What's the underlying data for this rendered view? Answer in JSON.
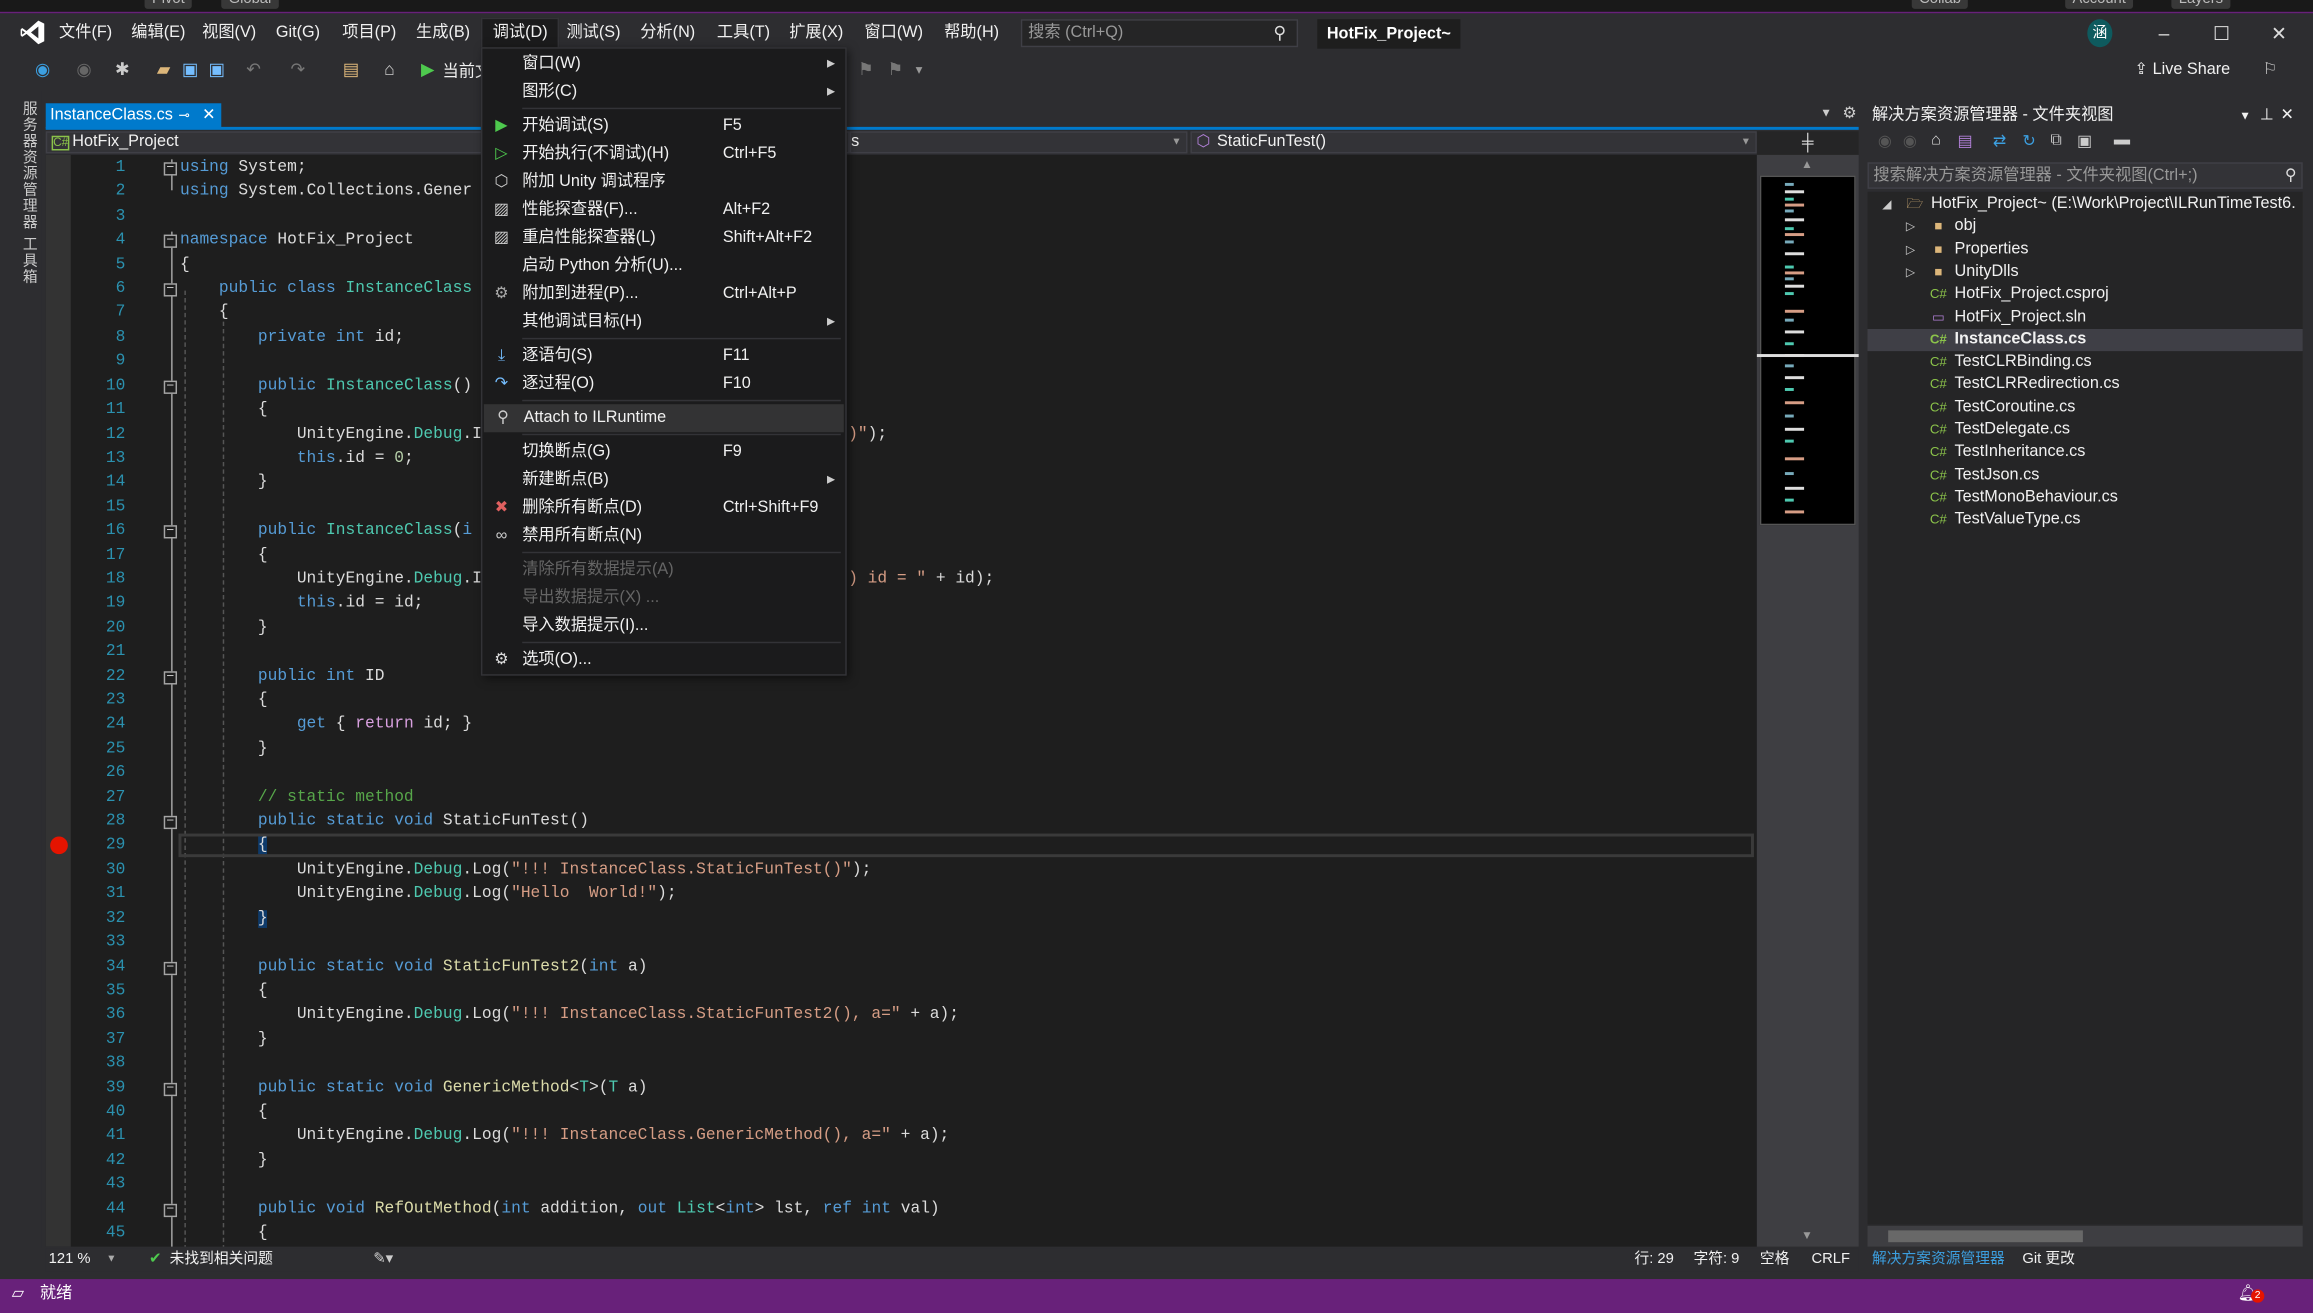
{
  "unity_bar": {
    "items": [
      "Pivot",
      "Global",
      "Collab",
      "Account",
      "Layers"
    ]
  },
  "menubar": {
    "items": [
      "文件(F)",
      "编辑(E)",
      "视图(V)",
      "Git(G)",
      "项目(P)",
      "生成(B)",
      "调试(D)",
      "测试(S)",
      "分析(N)",
      "工具(T)",
      "扩展(X)",
      "窗口(W)",
      "帮助(H)"
    ],
    "search_placeholder": "搜索 (Ctrl+Q)",
    "solution_title": "HotFix_Project~",
    "avatar": "涵"
  },
  "toolbar": {
    "start_label": "当前文",
    "live_share": "Live Share"
  },
  "left_strip": {
    "items": [
      "服务器资源管理器",
      "工具箱"
    ]
  },
  "document": {
    "tab_label": "InstanceClass.cs",
    "nav_project": "HotFix_Project",
    "nav_class_hint": "s",
    "nav_member": "StaticFunTest()"
  },
  "code": {
    "current_line": 29,
    "breakpoint_line": 29,
    "fold_lines": [
      1,
      4,
      6,
      10,
      16,
      22,
      28,
      34,
      39,
      44
    ],
    "lines": [
      {
        "n": "1",
        "t": [
          [
            "k",
            "using"
          ],
          [
            "p",
            " System;"
          ]
        ]
      },
      {
        "n": "2",
        "t": [
          [
            "k",
            "using"
          ],
          [
            "p",
            " System.Collections.Gener"
          ]
        ]
      },
      {
        "n": "3",
        "t": []
      },
      {
        "n": "4",
        "t": [
          [
            "k",
            "namespace"
          ],
          [
            "p",
            " HotFix_Project"
          ]
        ]
      },
      {
        "n": "5",
        "t": [
          [
            "p",
            "{"
          ]
        ]
      },
      {
        "n": "6",
        "t": [
          [
            "p",
            "    "
          ],
          [
            "k",
            "public class"
          ],
          [
            "p",
            " "
          ],
          [
            "t",
            "InstanceClass"
          ]
        ]
      },
      {
        "n": "7",
        "t": [
          [
            "p",
            "    {"
          ]
        ]
      },
      {
        "n": "8",
        "t": [
          [
            "p",
            "        "
          ],
          [
            "k",
            "private int"
          ],
          [
            "p",
            " id;"
          ]
        ]
      },
      {
        "n": "9",
        "t": []
      },
      {
        "n": "10",
        "t": [
          [
            "p",
            "        "
          ],
          [
            "k",
            "public"
          ],
          [
            "p",
            " "
          ],
          [
            "t",
            "InstanceClass"
          ],
          [
            "p",
            "()"
          ]
        ]
      },
      {
        "n": "11",
        "t": [
          [
            "p",
            "        {"
          ]
        ]
      },
      {
        "n": "12",
        "t": [
          [
            "p",
            "            UnityEngine."
          ],
          [
            "t",
            "Debug"
          ],
          [
            "p",
            ".I"
          ]
        ],
        "tail": [
          [
            "s",
            ")\""
          ],
          [
            "p",
            ");"
          ]
        ]
      },
      {
        "n": "13",
        "t": [
          [
            "p",
            "            "
          ],
          [
            "k",
            "this"
          ],
          [
            "p",
            ".id = "
          ],
          [
            "n",
            "0"
          ],
          [
            "p",
            ";"
          ]
        ]
      },
      {
        "n": "14",
        "t": [
          [
            "p",
            "        }"
          ]
        ]
      },
      {
        "n": "15",
        "t": []
      },
      {
        "n": "16",
        "t": [
          [
            "p",
            "        "
          ],
          [
            "k",
            "public"
          ],
          [
            "p",
            " "
          ],
          [
            "t",
            "InstanceClass"
          ],
          [
            "p",
            "("
          ],
          [
            "k",
            "i"
          ]
        ]
      },
      {
        "n": "17",
        "t": [
          [
            "p",
            "        {"
          ]
        ]
      },
      {
        "n": "18",
        "t": [
          [
            "p",
            "            UnityEngine."
          ],
          [
            "t",
            "Debug"
          ],
          [
            "p",
            ".I"
          ]
        ],
        "tail": [
          [
            "s",
            ") id = \""
          ],
          [
            "p",
            " + id);"
          ]
        ]
      },
      {
        "n": "19",
        "t": [
          [
            "p",
            "            "
          ],
          [
            "k",
            "this"
          ],
          [
            "p",
            ".id = id;"
          ]
        ]
      },
      {
        "n": "20",
        "t": [
          [
            "p",
            "        }"
          ]
        ]
      },
      {
        "n": "21",
        "t": []
      },
      {
        "n": "22",
        "t": [
          [
            "p",
            "        "
          ],
          [
            "k",
            "public int"
          ],
          [
            "p",
            " ID"
          ]
        ]
      },
      {
        "n": "23",
        "t": [
          [
            "p",
            "        {"
          ]
        ]
      },
      {
        "n": "24",
        "t": [
          [
            "p",
            "            "
          ],
          [
            "k",
            "get"
          ],
          [
            "p",
            " { "
          ],
          [
            "c",
            "return"
          ],
          [
            "p",
            " id; }"
          ]
        ]
      },
      {
        "n": "25",
        "t": [
          [
            "p",
            "        }"
          ]
        ]
      },
      {
        "n": "26",
        "t": []
      },
      {
        "n": "27",
        "t": [
          [
            "p",
            "        "
          ],
          [
            "g",
            "// static method"
          ]
        ]
      },
      {
        "n": "28",
        "t": [
          [
            "p",
            "        "
          ],
          [
            "k",
            "public static void"
          ],
          [
            "p",
            " StaticFunTest()"
          ]
        ]
      },
      {
        "n": "29",
        "t": [
          [
            "p",
            "        "
          ],
          [
            "b",
            "{"
          ]
        ]
      },
      {
        "n": "30",
        "t": [
          [
            "p",
            "            UnityEngine."
          ],
          [
            "t",
            "Debug"
          ],
          [
            "p",
            ".Log("
          ],
          [
            "s",
            "\"!!! InstanceClass.StaticFunTest()\""
          ],
          [
            "p",
            ");"
          ]
        ]
      },
      {
        "n": "31",
        "t": [
          [
            "p",
            "            UnityEngine."
          ],
          [
            "t",
            "Debug"
          ],
          [
            "p",
            ".Log("
          ],
          [
            "s",
            "\"Hello  World!\""
          ],
          [
            "p",
            ");"
          ]
        ]
      },
      {
        "n": "32",
        "t": [
          [
            "p",
            "        "
          ],
          [
            "b",
            "}"
          ]
        ]
      },
      {
        "n": "33",
        "t": []
      },
      {
        "n": "34",
        "t": [
          [
            "p",
            "        "
          ],
          [
            "k",
            "public static void"
          ],
          [
            "p",
            " "
          ],
          [
            "m",
            "StaticFunTest2"
          ],
          [
            "p",
            "("
          ],
          [
            "k",
            "int"
          ],
          [
            "p",
            " a)"
          ]
        ]
      },
      {
        "n": "35",
        "t": [
          [
            "p",
            "        {"
          ]
        ]
      },
      {
        "n": "36",
        "t": [
          [
            "p",
            "            UnityEngine."
          ],
          [
            "t",
            "Debug"
          ],
          [
            "p",
            ".Log("
          ],
          [
            "s",
            "\"!!! InstanceClass.StaticFunTest2(), a=\""
          ],
          [
            "p",
            " + a);"
          ]
        ]
      },
      {
        "n": "37",
        "t": [
          [
            "p",
            "        }"
          ]
        ]
      },
      {
        "n": "38",
        "t": []
      },
      {
        "n": "39",
        "t": [
          [
            "p",
            "        "
          ],
          [
            "k",
            "public static void"
          ],
          [
            "p",
            " "
          ],
          [
            "m",
            "GenericMethod"
          ],
          [
            "p",
            "<"
          ],
          [
            "t",
            "T"
          ],
          [
            "p",
            ">("
          ],
          [
            "t",
            "T"
          ],
          [
            "p",
            " a)"
          ]
        ]
      },
      {
        "n": "40",
        "t": [
          [
            "p",
            "        {"
          ]
        ]
      },
      {
        "n": "41",
        "t": [
          [
            "p",
            "            UnityEngine."
          ],
          [
            "t",
            "Debug"
          ],
          [
            "p",
            ".Log("
          ],
          [
            "s",
            "\"!!! InstanceClass.GenericMethod(), a=\""
          ],
          [
            "p",
            " + a);"
          ]
        ]
      },
      {
        "n": "42",
        "t": [
          [
            "p",
            "        }"
          ]
        ]
      },
      {
        "n": "43",
        "t": []
      },
      {
        "n": "44",
        "t": [
          [
            "p",
            "        "
          ],
          [
            "k",
            "public void"
          ],
          [
            "p",
            " "
          ],
          [
            "m",
            "RefOutMethod"
          ],
          [
            "p",
            "("
          ],
          [
            "k",
            "int"
          ],
          [
            "p",
            " addition, "
          ],
          [
            "k",
            "out"
          ],
          [
            "p",
            " "
          ],
          [
            "t",
            "List"
          ],
          [
            "p",
            "<"
          ],
          [
            "k",
            "int"
          ],
          [
            "p",
            "> lst, "
          ],
          [
            "k",
            "ref int"
          ],
          [
            "p",
            " val)"
          ]
        ]
      },
      {
        "n": "45",
        "t": [
          [
            "p",
            "        {"
          ]
        ]
      }
    ]
  },
  "debug_menu": {
    "items": [
      {
        "type": "item",
        "label": "窗口(W)",
        "submenu": true
      },
      {
        "type": "item",
        "label": "图形(C)",
        "submenu": true
      },
      {
        "type": "sep"
      },
      {
        "type": "item",
        "label": "开始调试(S)",
        "shortcut": "F5",
        "icon": "play-icon"
      },
      {
        "type": "item",
        "label": "开始执行(不调试)(H)",
        "shortcut": "Ctrl+F5",
        "icon": "play-outline-icon"
      },
      {
        "type": "item",
        "label": "附加 Unity 调试程序",
        "icon": "unity-cube-icon"
      },
      {
        "type": "item",
        "label": "性能探查器(F)...",
        "shortcut": "Alt+F2",
        "icon": "performance-chart-icon"
      },
      {
        "type": "item",
        "label": "重启性能探查器(L)",
        "shortcut": "Shift+Alt+F2",
        "icon": "performance-chart-icon"
      },
      {
        "type": "item",
        "label": "启动 Python 分析(U)..."
      },
      {
        "type": "item",
        "label": "附加到进程(P)...",
        "shortcut": "Ctrl+Alt+P",
        "icon": "gears-icon"
      },
      {
        "type": "item",
        "label": "其他调试目标(H)",
        "submenu": true
      },
      {
        "type": "sep"
      },
      {
        "type": "item",
        "label": "逐语句(S)",
        "shortcut": "F11",
        "icon": "step-into-icon"
      },
      {
        "type": "item",
        "label": "逐过程(O)",
        "shortcut": "F10",
        "icon": "step-over-icon"
      },
      {
        "type": "sep"
      },
      {
        "type": "item",
        "label": "Attach to ILRuntime",
        "icon": "magnifier-icon",
        "highlighted": true
      },
      {
        "type": "sep"
      },
      {
        "type": "item",
        "label": "切换断点(G)",
        "shortcut": "F9"
      },
      {
        "type": "item",
        "label": "新建断点(B)",
        "submenu": true
      },
      {
        "type": "item",
        "label": "删除所有断点(D)",
        "shortcut": "Ctrl+Shift+F9",
        "icon": "delete-breakpoints-icon"
      },
      {
        "type": "item",
        "label": "禁用所有断点(N)",
        "icon": "disable-breakpoints-icon"
      },
      {
        "type": "sep"
      },
      {
        "type": "item",
        "label": "清除所有数据提示(A)",
        "disabled": true
      },
      {
        "type": "item",
        "label": "导出数据提示(X) ...",
        "disabled": true
      },
      {
        "type": "item",
        "label": "导入数据提示(I)..."
      },
      {
        "type": "sep"
      },
      {
        "type": "item",
        "label": "选项(O)...",
        "icon": "gear-icon"
      }
    ]
  },
  "solution_explorer": {
    "title": "解决方案资源管理器 - 文件夹视图",
    "search_placeholder": "搜索解决方案资源管理器 - 文件夹视图(Ctrl+;)",
    "tree": [
      {
        "label": "HotFix_Project~ (E:\\Work\\Project\\ILRunTimeTest6.",
        "kind": "root-folder",
        "level": 0,
        "expanded": true
      },
      {
        "label": "obj",
        "kind": "folder",
        "level": 1
      },
      {
        "label": "Properties",
        "kind": "folder",
        "level": 1
      },
      {
        "label": "UnityDlls",
        "kind": "folder",
        "level": 1
      },
      {
        "label": "HotFix_Project.csproj",
        "kind": "csproj",
        "level": 1
      },
      {
        "label": "HotFix_Project.sln",
        "kind": "sln",
        "level": 1
      },
      {
        "label": "InstanceClass.cs",
        "kind": "cs",
        "level": 1,
        "selected": true
      },
      {
        "label": "TestCLRBinding.cs",
        "kind": "cs",
        "level": 1
      },
      {
        "label": "TestCLRRedirection.cs",
        "kind": "cs",
        "level": 1
      },
      {
        "label": "TestCoroutine.cs",
        "kind": "cs",
        "level": 1
      },
      {
        "label": "TestDelegate.cs",
        "kind": "cs",
        "level": 1
      },
      {
        "label": "TestInheritance.cs",
        "kind": "cs",
        "level": 1
      },
      {
        "label": "TestJson.cs",
        "kind": "cs",
        "level": 1
      },
      {
        "label": "TestMonoBehaviour.cs",
        "kind": "cs",
        "level": 1
      },
      {
        "label": "TestValueType.cs",
        "kind": "cs",
        "level": 1
      }
    ],
    "bottom_tabs": [
      "解决方案资源管理器",
      "Git 更改"
    ]
  },
  "editor_status": {
    "zoom": "121 %",
    "issues": "未找到相关问题",
    "line": "行: 29",
    "char": "字符: 9",
    "spaces": "空格",
    "eol": "CRLF"
  },
  "statusbar": {
    "text": "就绪",
    "notifications": "2"
  },
  "colors": {
    "accent": "#007acc",
    "status_bar": "#68217a",
    "breakpoint": "#e51400"
  }
}
